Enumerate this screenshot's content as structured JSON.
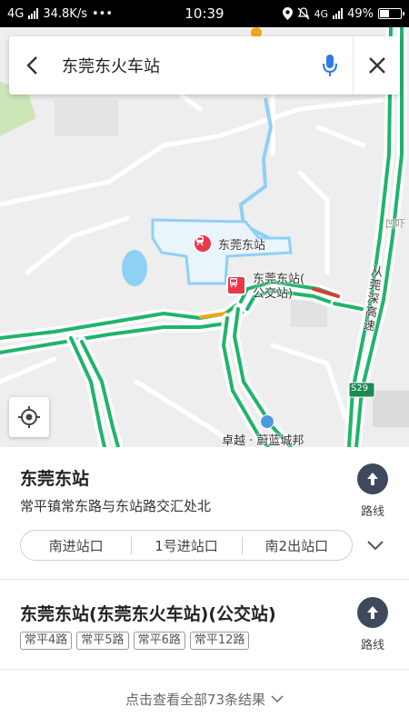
{
  "status_bar": {
    "network": "4G",
    "speed": "34.8K/s",
    "more": "•••",
    "time": "10:39",
    "net_right": "4G",
    "battery": "49%",
    "battery_level": 0.49
  },
  "search": {
    "query": "东莞东火车站"
  },
  "map": {
    "poi_station": "东莞东站",
    "poi_bus_line1": "东莞东站(",
    "poi_bus_line2": "公交站)",
    "poi_bottom": "卓越 · 蔚蓝城邦",
    "road_right": "从莞深高速",
    "road_shield": "S29",
    "edge_label": "凹吓",
    "colors": {
      "road": "#1fb46b",
      "congestion_orange": "#f2a516",
      "congestion_red": "#e03a3a",
      "water": "#8fd0f5",
      "station_marker": "#e8384a"
    }
  },
  "results": [
    {
      "title": "东莞东站",
      "address": "常平镇常东路与东站路交汇处北",
      "route_label": "路线",
      "entrances": [
        "南进站口",
        "1号进站口",
        "南2出站口"
      ]
    },
    {
      "title": "东莞东站(东莞东火车站)(公交站)",
      "route_label": "路线",
      "lines": [
        "常平4路",
        "常平5路",
        "常平6路",
        "常平12路"
      ]
    }
  ],
  "more_results_label": "点击查看全部73条结果"
}
